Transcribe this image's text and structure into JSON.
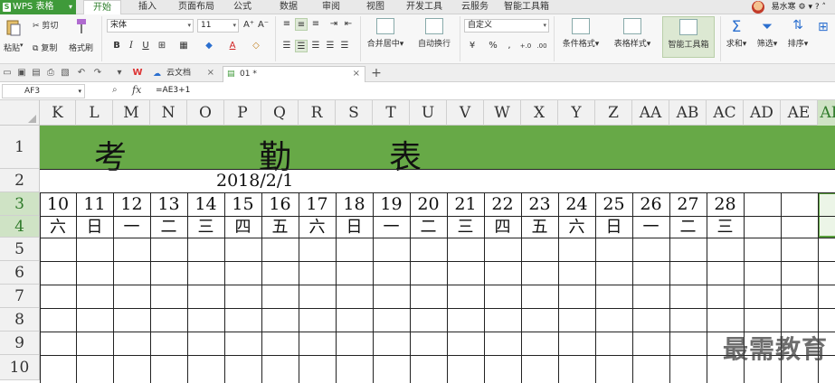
{
  "app": {
    "name": "WPS 表格",
    "logo": "S"
  },
  "menu_tabs": [
    "开始",
    "插入",
    "页面布局",
    "公式",
    "数据",
    "审阅",
    "视图",
    "开发工具",
    "云服务",
    "智能工具箱"
  ],
  "active_tab": "开始",
  "user": {
    "name": "易水寒"
  },
  "ribbon": {
    "paste": "粘贴",
    "cut": "剪切",
    "copy": "复制",
    "format_painter": "格式刷",
    "font_name": "宋体",
    "font_size": "11",
    "grow": "A⁺",
    "shrink": "A⁻",
    "bold": "B",
    "italic": "I",
    "underline": "U",
    "merge": "合并居中",
    "wrap": "自动换行",
    "number_format": "自定义",
    "currency": "¥",
    "percent": "%",
    "thousands": ",",
    "inc_dec": "+.0",
    "dec_dec": ".00",
    "cond_format": "条件格式",
    "table_style": "表格样式",
    "smart_toolbox": "智能工具箱",
    "sum": "求和",
    "filter": "筛选",
    "sort": "排序"
  },
  "doc_tabs": [
    {
      "label": "云文档"
    },
    {
      "label": "01 *"
    }
  ],
  "formula_bar": {
    "name_box": "AF3",
    "fx": "fx",
    "formula": "=AE3+1"
  },
  "columns": [
    "K",
    "L",
    "M",
    "N",
    "O",
    "P",
    "Q",
    "R",
    "S",
    "T",
    "U",
    "V",
    "W",
    "X",
    "Y",
    "Z",
    "AA",
    "AB",
    "AC",
    "AD",
    "AE",
    "AF"
  ],
  "active_column": "AF",
  "rows": [
    "1",
    "2",
    "3",
    "4",
    "5",
    "6",
    "7",
    "8",
    "9",
    "10"
  ],
  "active_rows": [
    "3",
    "4"
  ],
  "sheet": {
    "title_chars": [
      "考",
      "勤",
      "表"
    ],
    "date": "2018/2/1",
    "day_numbers": [
      "10",
      "11",
      "12",
      "13",
      "14",
      "15",
      "16",
      "17",
      "18",
      "19",
      "20",
      "21",
      "22",
      "23",
      "24",
      "25",
      "26",
      "27",
      "28"
    ],
    "weekdays": [
      "六",
      "日",
      "一",
      "二",
      "三",
      "四",
      "五",
      "六",
      "日",
      "一",
      "二",
      "三",
      "四",
      "五",
      "六",
      "日",
      "一",
      "二",
      "三"
    ]
  },
  "watermark": "最需教育",
  "colors": {
    "brand": "#3f9a3a",
    "title_band": "#67a947",
    "active_header": "#cfe3c5"
  }
}
